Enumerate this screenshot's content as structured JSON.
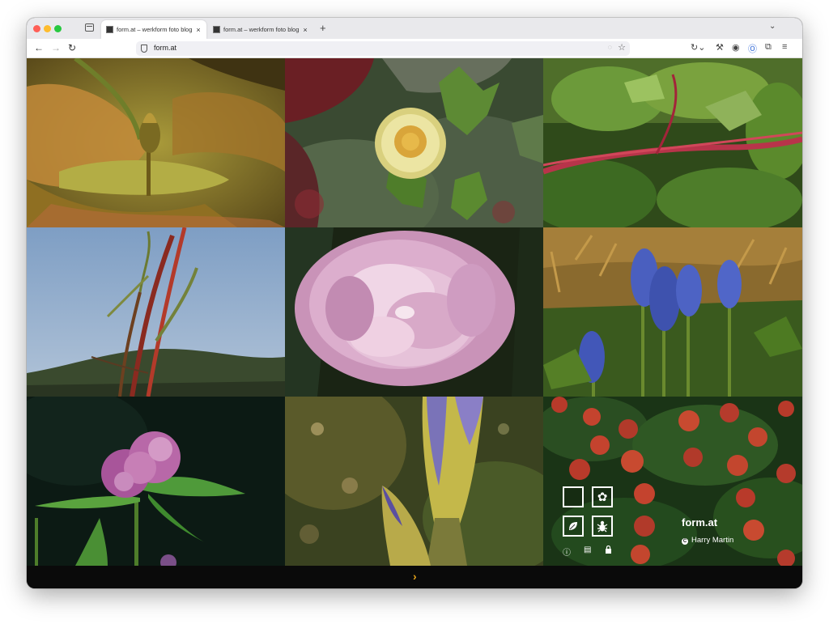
{
  "browser": {
    "tabs": [
      {
        "title": "form.at – werkform foto blog",
        "active": true
      },
      {
        "title": "form.at – werkform foto blog",
        "active": false
      }
    ],
    "new_tab_symbol": "+",
    "tab_close_symbol": "×",
    "address": "form.at"
  },
  "gallery": {
    "photos": [
      {
        "subject": "water lily bud"
      },
      {
        "subject": "yellow water lily with ivy"
      },
      {
        "subject": "red vine with green leaves"
      },
      {
        "subject": "dry reed stems against sky"
      },
      {
        "subject": "pink peony"
      },
      {
        "subject": "grape hyacinth"
      },
      {
        "subject": "red clover"
      },
      {
        "subject": "iris bud"
      },
      {
        "subject": "red berries and leaves"
      }
    ],
    "next_symbol": "›"
  },
  "site": {
    "brand": "form.at",
    "credit_symbol": "C",
    "credit_name": "Harry Martin",
    "logo_icons": [
      "empty-square-icon",
      "flower-icon",
      "leaf-icon",
      "bug-icon"
    ],
    "footer_icons": [
      "info-icon",
      "contact-card-icon",
      "lock-icon"
    ]
  },
  "colors": {
    "accent_arrow": "#e3a21a",
    "footer_bg": "#0a0a0a"
  }
}
